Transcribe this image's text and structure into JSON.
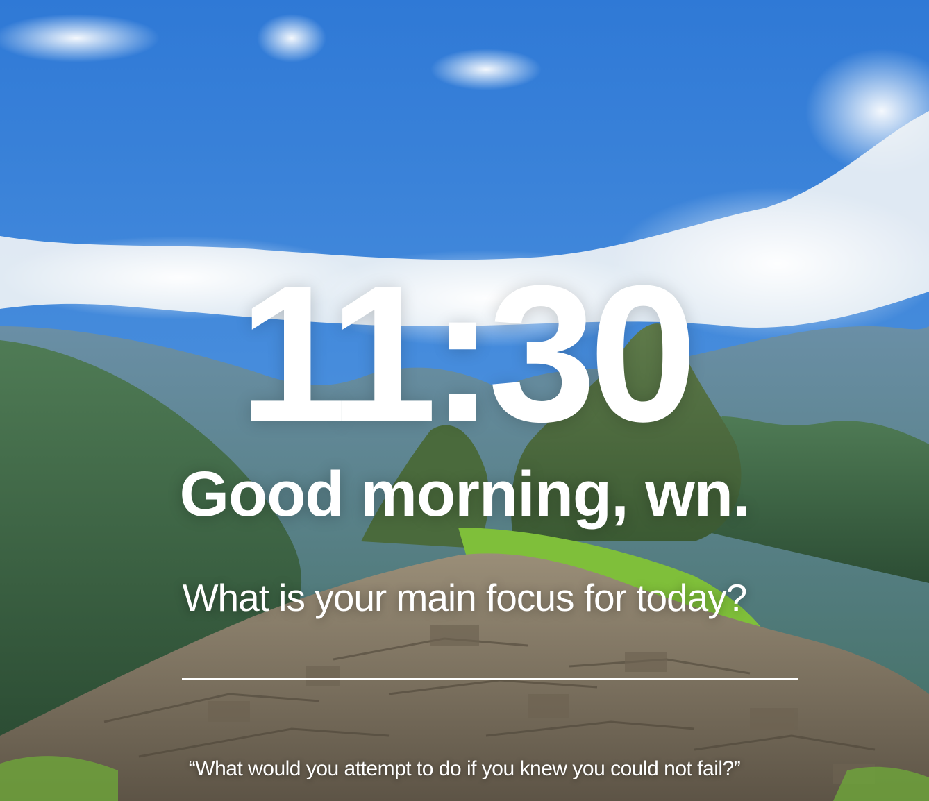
{
  "clock": {
    "time": "11:30"
  },
  "greeting": {
    "prefix": "Good morning, ",
    "name": "wn."
  },
  "focus": {
    "prompt": "What is your main focus for today?",
    "value": ""
  },
  "quote": {
    "text": "“What would you attempt to do if you knew you could not fail?”"
  },
  "background": {
    "scene": "mountain-ruins-landscape",
    "sky_color": "#3f86d8",
    "cloud_color": "#f2f4f6",
    "mountain_color": "#3d6a4e",
    "grass_color": "#7fbf3a",
    "stone_color": "#8b7f6c"
  }
}
